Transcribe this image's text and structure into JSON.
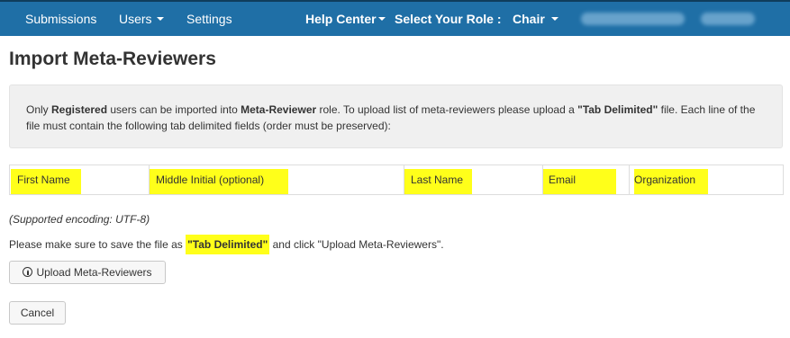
{
  "colors": {
    "navbar": "#1f6fa6",
    "highlight": "#ffff1a",
    "info_bg": "#f0f0f0"
  },
  "nav": {
    "submissions": "Submissions",
    "users": "Users",
    "settings": "Settings",
    "help_center": "Help Center",
    "role_label": "Select Your Role :",
    "role_value": "Chair"
  },
  "page": {
    "title": "Import Meta-Reviewers"
  },
  "info": {
    "t1": "Only ",
    "b1": "Registered",
    "t2": " users can be imported into ",
    "b2": "Meta-Reviewer",
    "t3": " role. To upload list of meta-reviewers please upload a ",
    "b3": "\"Tab Delimited\"",
    "t4": " file. Each line of the file must contain the following tab delimited fields (order must be preserved):"
  },
  "fields": {
    "first_name": "First Name",
    "middle_initial": "Middle Initial (optional)",
    "last_name": "Last Name",
    "email": "Email",
    "organization": "Organization"
  },
  "encoding_note": "(Supported encoding: UTF-8)",
  "save_note": {
    "prefix": "Please make sure to save the file as ",
    "highlight": "\"Tab Delimited\"",
    "suffix": " and click \"Upload Meta-Reviewers\"."
  },
  "buttons": {
    "upload_icon": "upload-circle-icon",
    "upload": "Upload Meta-Reviewers",
    "cancel": "Cancel"
  }
}
